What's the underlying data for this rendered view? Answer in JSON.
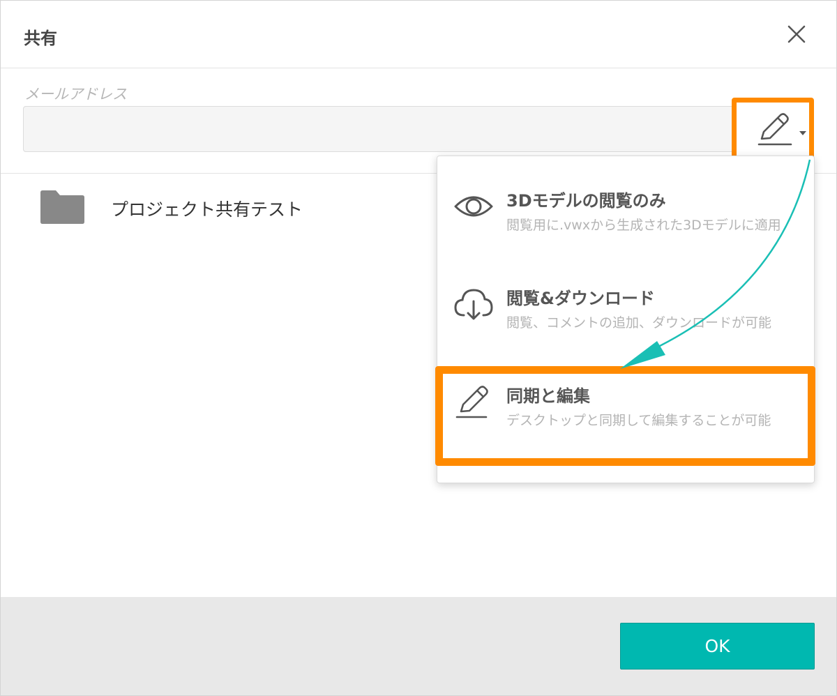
{
  "dialog": {
    "title": "共有",
    "close_icon": "close-icon"
  },
  "email": {
    "label": "メールアドレス",
    "value": "",
    "placeholder": ""
  },
  "permission_button": {
    "icon": "pencil-icon",
    "caret_icon": "caret-down-icon"
  },
  "folder": {
    "icon": "folder-icon",
    "name": "プロジェクト共有テスト"
  },
  "permission_menu": {
    "items": [
      {
        "icon": "eye-icon",
        "title": "3Dモデルの閲覧のみ",
        "description": "閲覧用に.vwxから生成された3Dモデルに適用"
      },
      {
        "icon": "cloud-download-icon",
        "title": "閲覧&ダウンロード",
        "description": "閲覧、コメントの追加、ダウンロードが可能"
      },
      {
        "icon": "pencil-icon",
        "title": "同期と編集",
        "description": "デスクトップと同期して編集することが可能"
      }
    ]
  },
  "footer": {
    "ok_label": "OK"
  },
  "colors": {
    "accent": "#00b8b0",
    "highlight": "#ff8a00",
    "arrow": "#1abfb5"
  }
}
